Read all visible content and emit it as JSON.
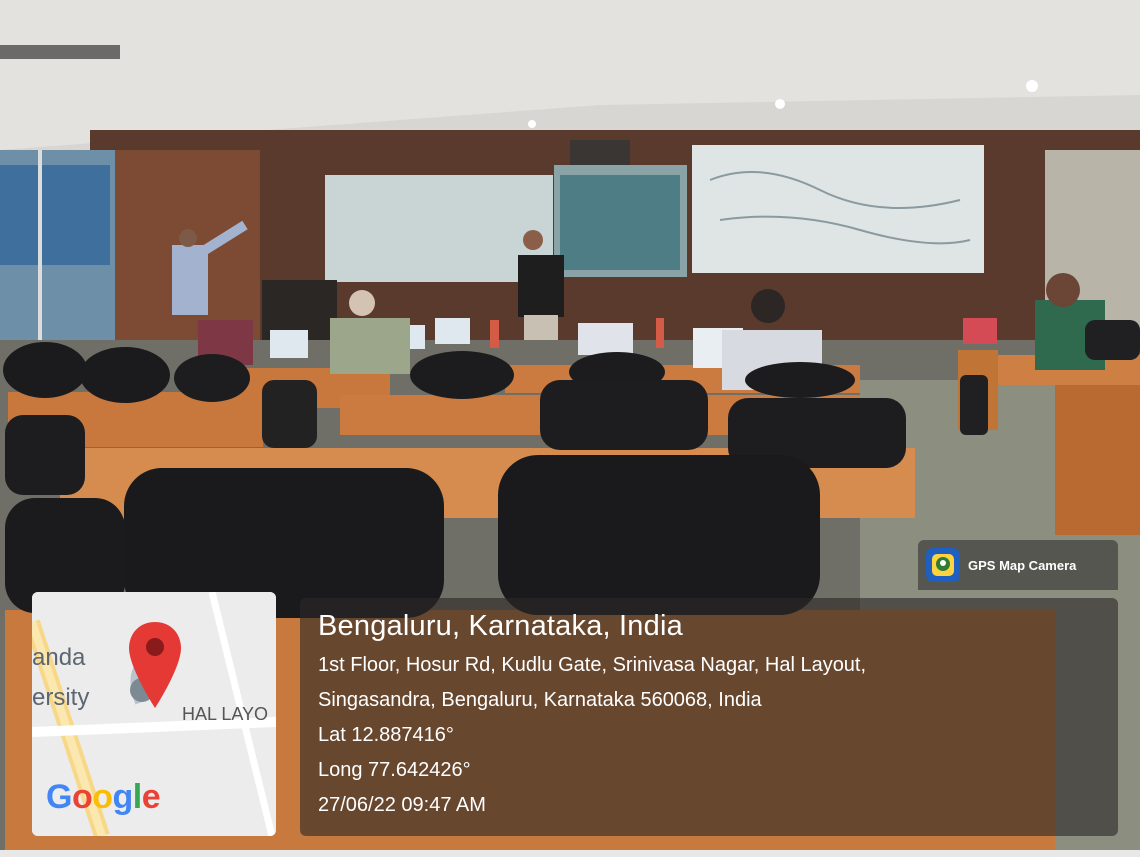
{
  "app": {
    "brand_label": "GPS Map Camera",
    "brand_icon": "gps-map-camera-icon"
  },
  "location": {
    "title": "Bengaluru, Karnataka, India",
    "address_line1": "1st Floor, Hosur Rd, Kudlu Gate, Srinivasa Nagar, Hal Layout,",
    "address_line2": "Singasandra, Bengaluru, Karnataka 560068, India",
    "lat": "Lat 12.887416°",
    "long": "Long 77.642426°",
    "datetime": "27/06/22 09:47 AM"
  },
  "map": {
    "label_left_top": "anda",
    "label_left_bottom": "ersity",
    "label_area": "HAL LAYO",
    "google": "Google",
    "pin_color": "#e53935"
  }
}
